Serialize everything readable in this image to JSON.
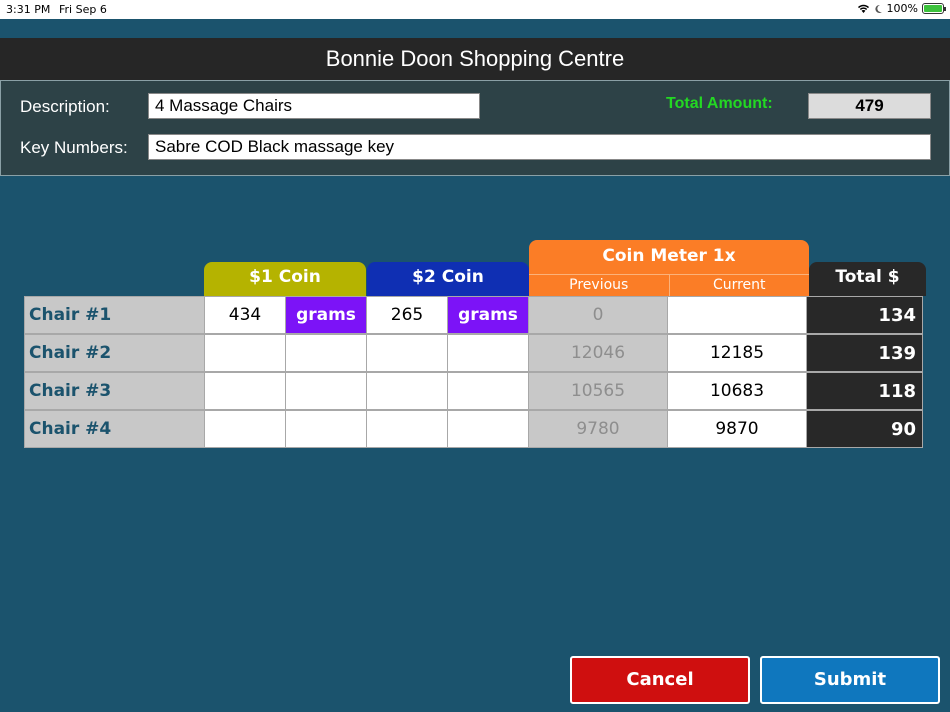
{
  "status": {
    "time": "3:31 PM",
    "date": "Fri Sep 6",
    "battery": "100%"
  },
  "title": "Bonnie Doon Shopping Centre",
  "form": {
    "description_label": "Description:",
    "description_value": "4 Massage Chairs",
    "key_label": "Key Numbers:",
    "key_value": "Sabre COD Black massage key",
    "total_label": "Total Amount:",
    "total_value": "479"
  },
  "headers": {
    "coin1": "$1 Coin",
    "coin2": "$2 Coin",
    "meter": "Coin Meter 1x",
    "previous": "Previous",
    "current": "Current",
    "total": "Total $"
  },
  "rows": [
    {
      "name": "Chair #1",
      "coin1": "434",
      "coin1_unit": "grams",
      "coin2": "265",
      "coin2_unit": "grams",
      "previous": "0",
      "current": "",
      "total": "134"
    },
    {
      "name": "Chair #2",
      "coin1": "",
      "coin1_unit": "",
      "coin2": "",
      "coin2_unit": "",
      "previous": "12046",
      "current": "12185",
      "total": "139"
    },
    {
      "name": "Chair #3",
      "coin1": "",
      "coin1_unit": "",
      "coin2": "",
      "coin2_unit": "",
      "previous": "10565",
      "current": "10683",
      "total": "118"
    },
    {
      "name": "Chair #4",
      "coin1": "",
      "coin1_unit": "",
      "coin2": "",
      "coin2_unit": "",
      "previous": "9780",
      "current": "9870",
      "total": "90"
    }
  ],
  "buttons": {
    "cancel": "Cancel",
    "submit": "Submit"
  },
  "colors": {
    "background": "#1b536d",
    "coin1": "#b5b300",
    "coin2": "#0f2fb3",
    "meter": "#fb7d26",
    "grams": "#7c13f7",
    "cancel": "#cf0f0f",
    "submit": "#0f77be",
    "total_label": "#23d823"
  }
}
